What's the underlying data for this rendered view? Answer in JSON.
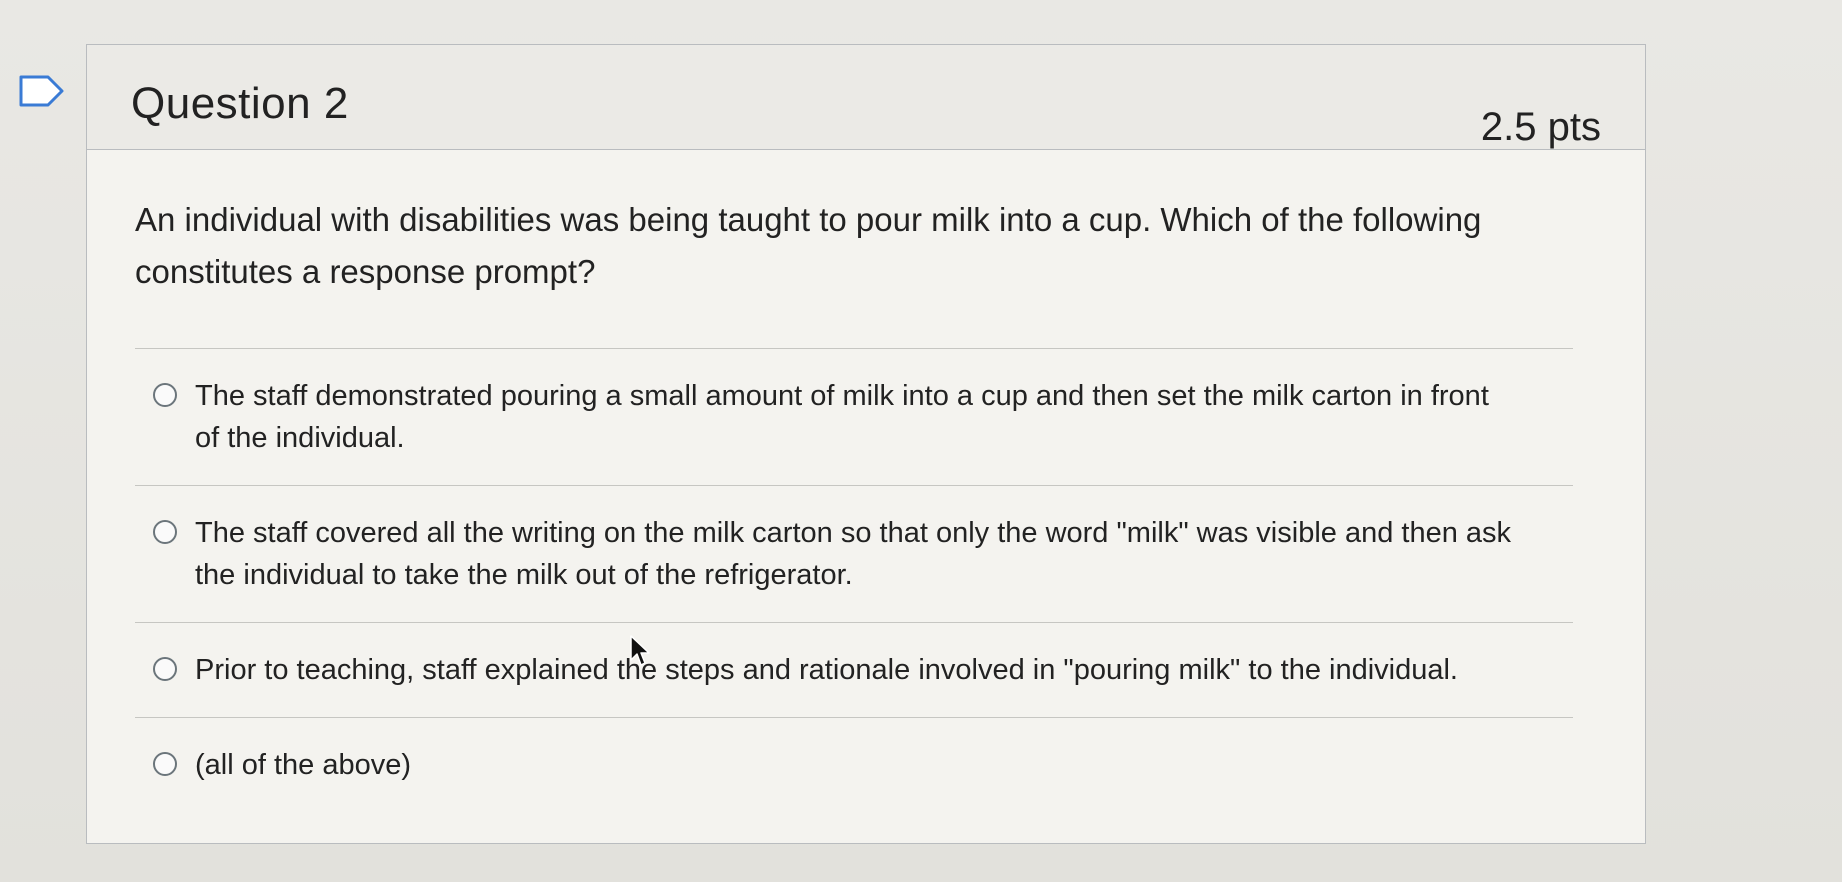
{
  "question": {
    "title": "Question 2",
    "points": "2.5 pts",
    "text": "An individual with disabilities was being taught to pour milk into a cup. Which of the following constitutes a response prompt?"
  },
  "answers": [
    {
      "label": "The staff demonstrated pouring a small amount of milk into a cup and then set the milk carton in front of the individual."
    },
    {
      "label": "The staff covered all the writing on the milk carton so that only the word \"milk\" was visible and then ask the individual to take the milk out of the refrigerator."
    },
    {
      "label": "Prior to teaching, staff explained the steps and rationale involved in \"pouring milk\" to the individual."
    },
    {
      "label": "(all of the above)"
    }
  ],
  "icons": {
    "flag": "flag-icon",
    "cursor": "mouse-cursor-icon",
    "radio": "radio-button-icon"
  }
}
